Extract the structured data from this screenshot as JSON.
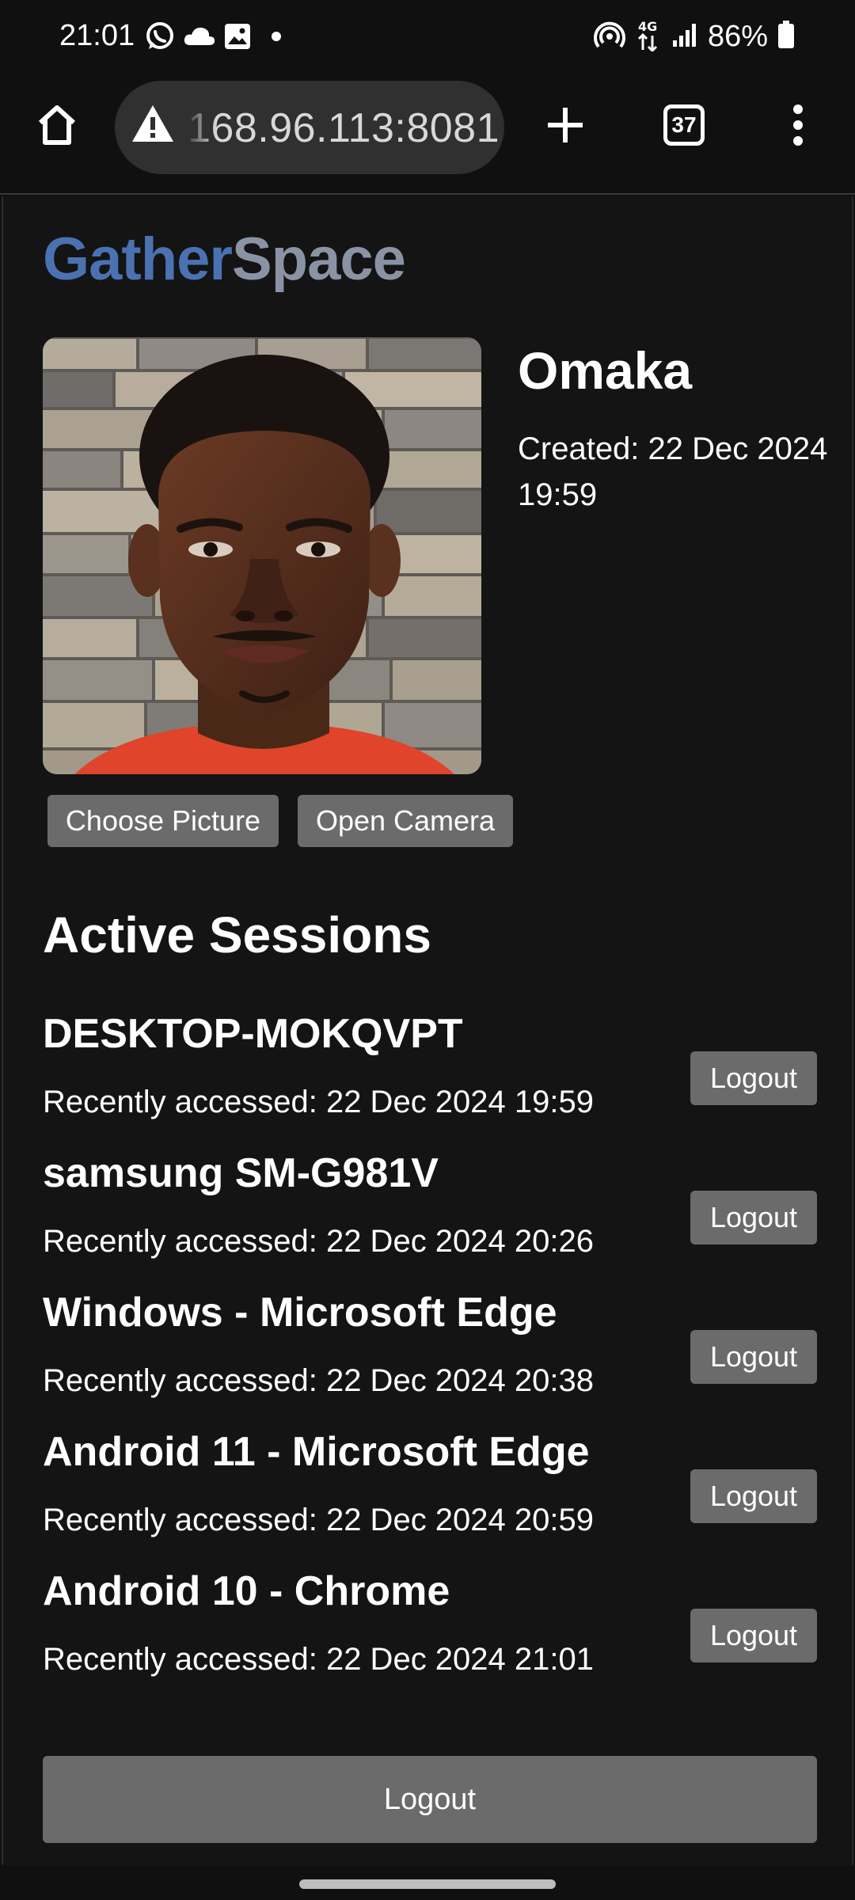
{
  "status_bar": {
    "time": "21:01",
    "left_icons": [
      "whatsapp-icon",
      "cloud-icon",
      "gallery-icon",
      "dot-icon"
    ],
    "right_icons": [
      "hotspot-icon",
      "4g-icon",
      "signal-icon",
      "battery-icon"
    ],
    "battery": "86%"
  },
  "browser": {
    "url": "168.96.113:8081",
    "tab_count": "37",
    "icons": [
      "home-icon",
      "warning-icon",
      "new-tab-icon",
      "tabs-icon",
      "menu-icon"
    ]
  },
  "app": {
    "logo_part1": "Gather",
    "logo_part2": "Space",
    "colors": {
      "logo_blue": "#4a72b2",
      "logo_gray": "#8a93a4",
      "button_gray": "#6b6b6b"
    }
  },
  "profile": {
    "name": "Omaka",
    "created": "Created: 22 Dec 2024 19:59",
    "choose_picture": "Choose Picture",
    "open_camera": "Open Camera"
  },
  "sessions": {
    "title": "Active Sessions",
    "items": [
      {
        "device": "DESKTOP-MOKQVPT",
        "accessed": "Recently accessed: 22 Dec 2024 19:59",
        "logout": "Logout"
      },
      {
        "device": "samsung SM-G981V",
        "accessed": "Recently accessed: 22 Dec 2024 20:26",
        "logout": "Logout"
      },
      {
        "device": "Windows - Microsoft Edge",
        "accessed": "Recently accessed: 22 Dec 2024 20:38",
        "logout": "Logout"
      },
      {
        "device": "Android 11 - Microsoft Edge",
        "accessed": "Recently accessed: 22 Dec 2024 20:59",
        "logout": "Logout"
      },
      {
        "device": "Android 10 - Chrome",
        "accessed": "Recently accessed: 22 Dec 2024 21:01",
        "logout": "Logout"
      }
    ]
  },
  "footer": {
    "logout": "Logout"
  }
}
